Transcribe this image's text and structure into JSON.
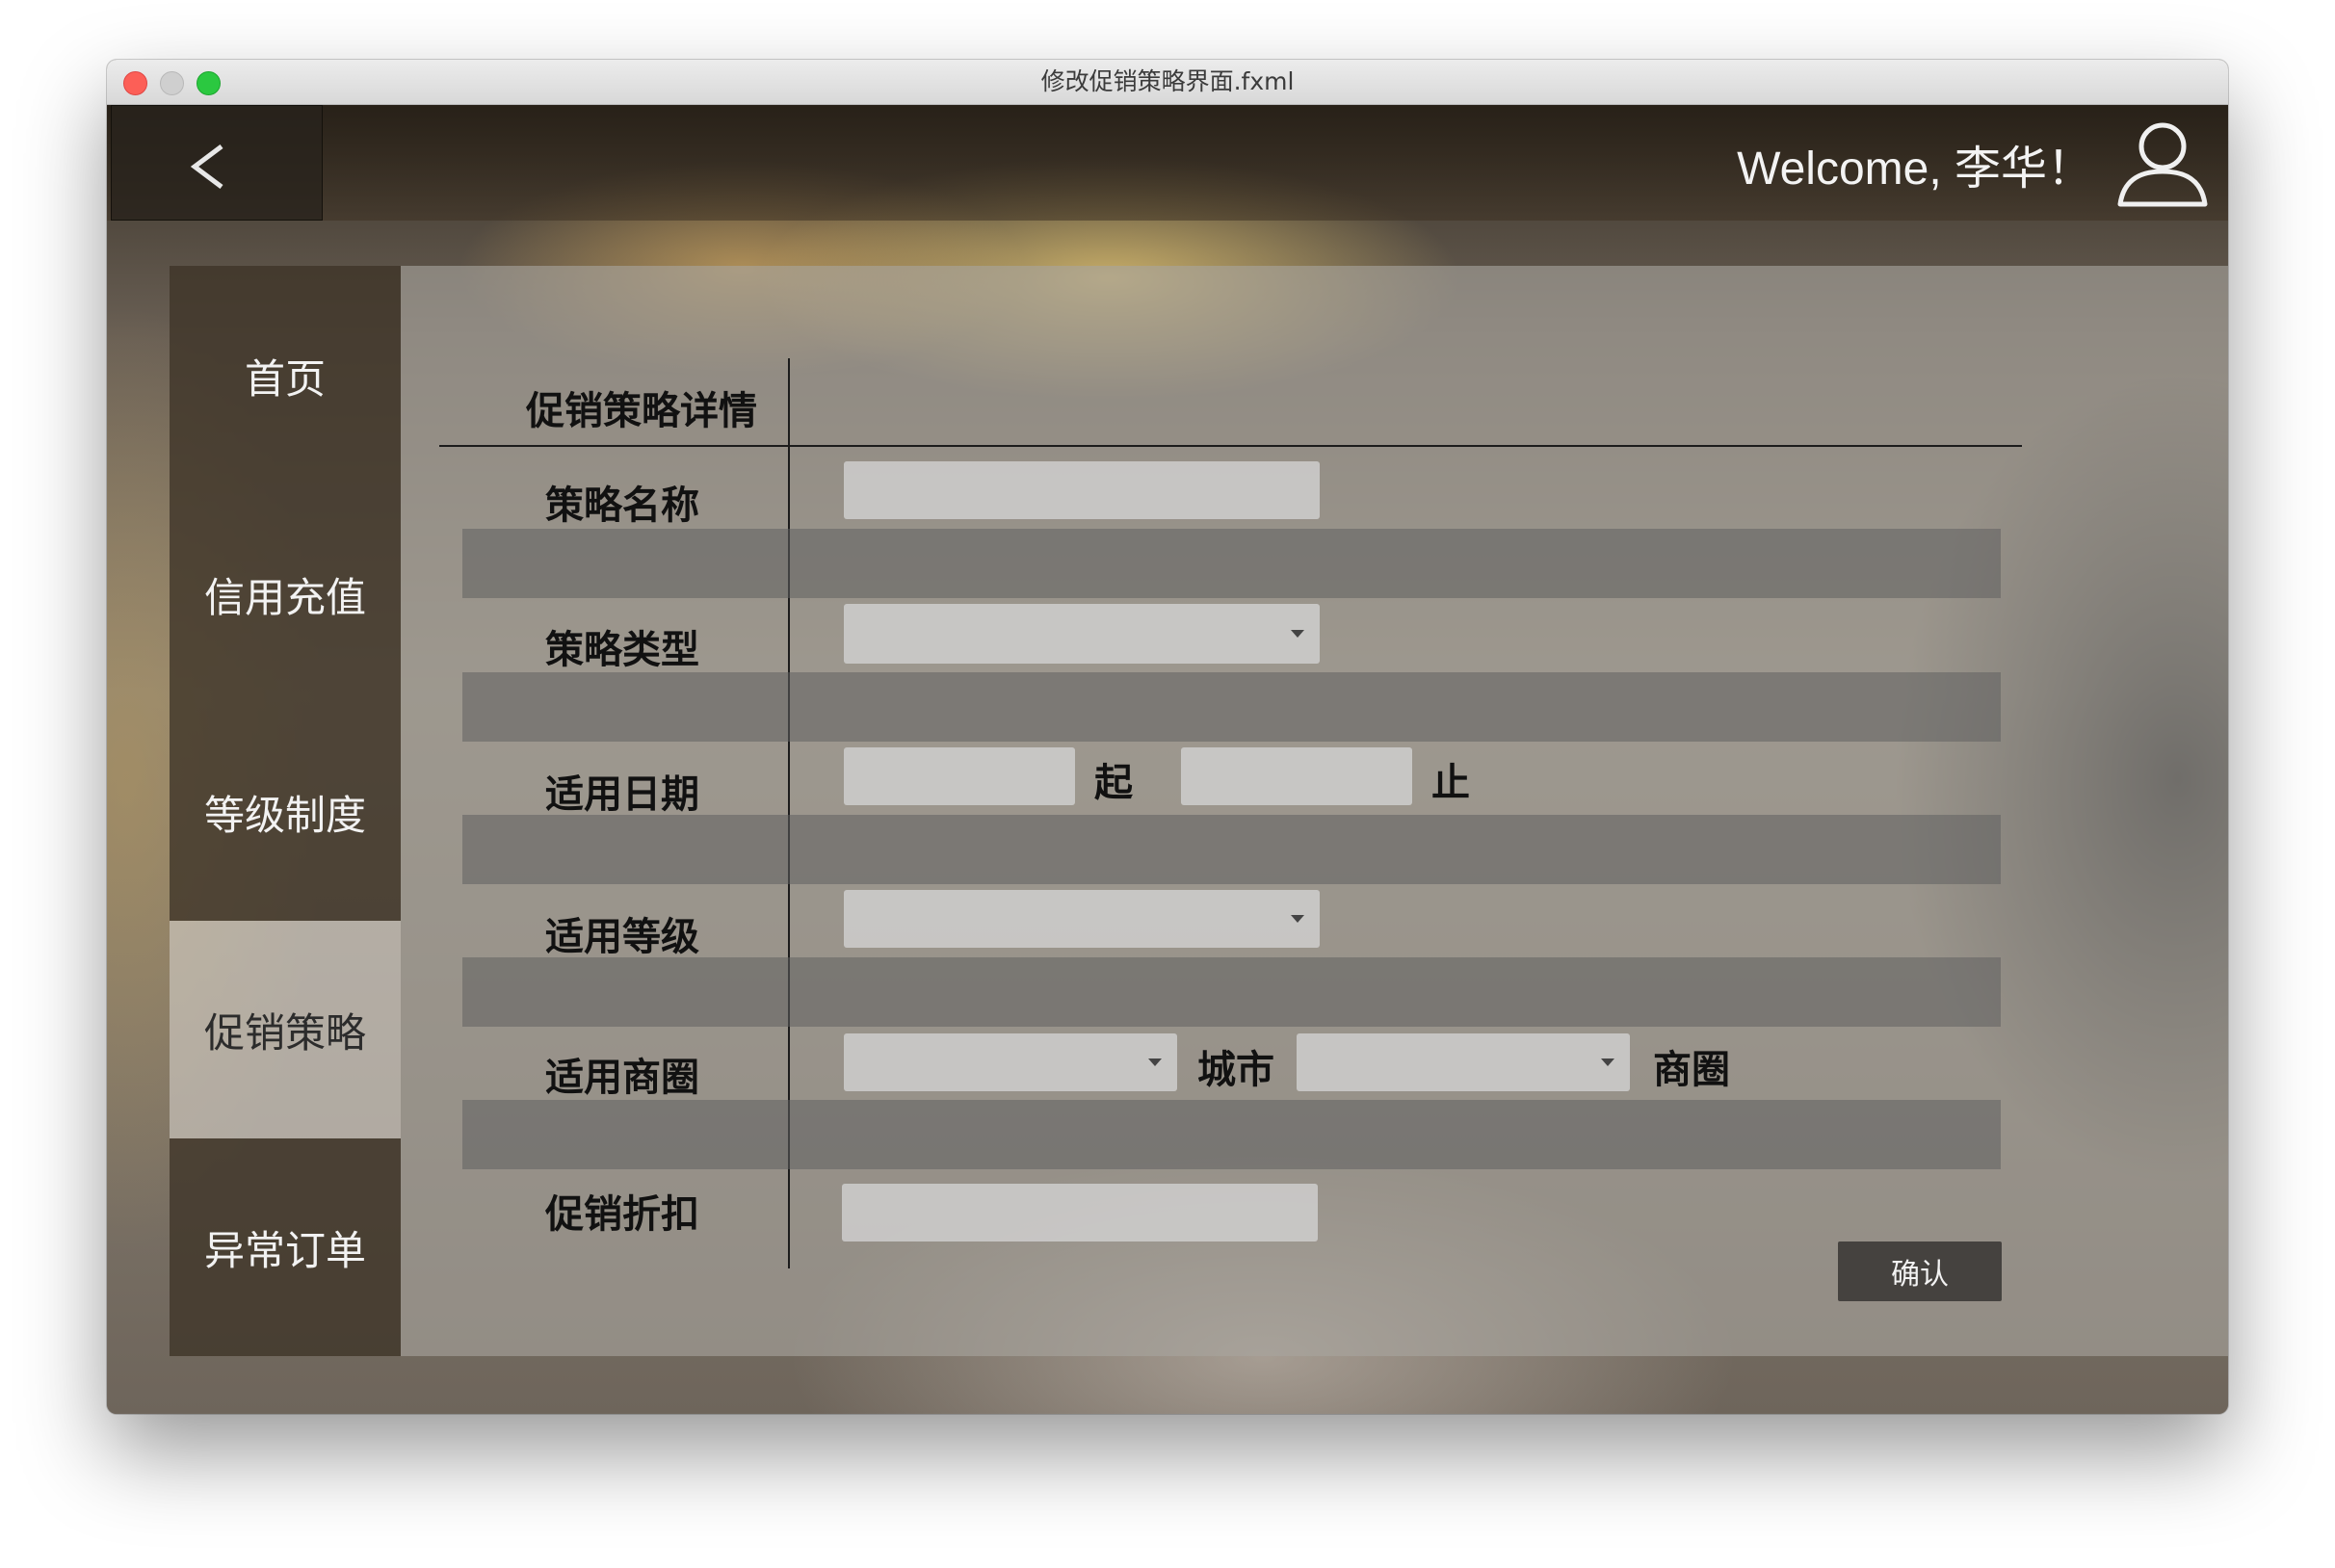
{
  "window": {
    "title": "修改促销策略界面.fxml"
  },
  "header": {
    "back_label": "<",
    "welcome_text": "Welcome, 李华！",
    "user_icon": "user-icon"
  },
  "sidebar": {
    "items": [
      {
        "label": "首页",
        "active": false
      },
      {
        "label": "信用充值",
        "active": false
      },
      {
        "label": "等级制度",
        "active": false
      },
      {
        "label": "促销策略",
        "active": true
      },
      {
        "label": "异常订单",
        "active": false
      }
    ]
  },
  "form": {
    "section_title": "促销策略详情",
    "rows": {
      "name": {
        "label": "策略名称",
        "value": ""
      },
      "type": {
        "label": "策略类型",
        "selected": ""
      },
      "date": {
        "label": "适用日期",
        "start_value": "",
        "start_suffix": "起",
        "end_value": "",
        "end_suffix": "止"
      },
      "level": {
        "label": "适用等级",
        "selected": ""
      },
      "district": {
        "label": "适用商圈",
        "city_selected": "",
        "city_suffix": "城市",
        "area_selected": "",
        "area_suffix": "商圈"
      },
      "discount": {
        "label": "促销折扣",
        "value": ""
      }
    },
    "confirm_label": "确认"
  },
  "colors": {
    "active_nav": "#d2cdc6",
    "nav": "#3e3428",
    "confirm_button": "#3a3836",
    "close_button": "#fc5f57",
    "zoom_button": "#2bc840"
  }
}
